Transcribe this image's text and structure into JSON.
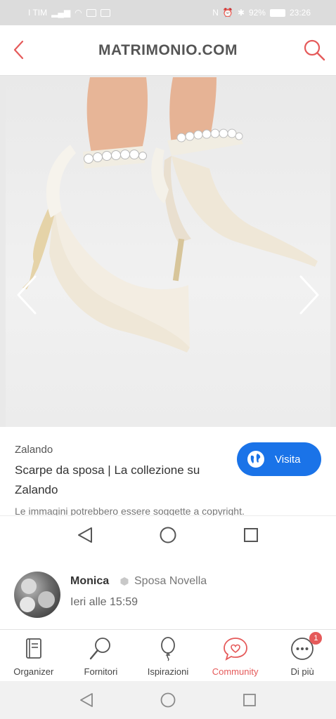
{
  "status_bar": {
    "carrier": "I TIM",
    "battery": "92%",
    "time": "23:26"
  },
  "header": {
    "title": "MATRIMONIO.COM",
    "back_icon": "chevron-left-icon",
    "search_icon": "search-icon"
  },
  "gallery": {
    "prev_icon": "chevron-left-icon",
    "next_icon": "chevron-right-icon"
  },
  "card": {
    "source": "Zalando",
    "title": "Scarpe da sposa | La collezione su Zalando",
    "visit_label": "Visita",
    "copyright": "Le immagini potrebbero essere soggette a copyright."
  },
  "post": {
    "user": "Monica",
    "role": "Sposa Novella",
    "time": "Ieri alle 15:59"
  },
  "tabs": [
    {
      "label": "Organizer",
      "icon": "book-icon"
    },
    {
      "label": "Fornitori",
      "icon": "magnifier-icon"
    },
    {
      "label": "Ispirazioni",
      "icon": "balloon-icon"
    },
    {
      "label": "Community",
      "icon": "chat-heart-icon"
    },
    {
      "label": "Di più",
      "icon": "more-icon",
      "badge": "1"
    }
  ],
  "colors": {
    "accent": "#e55a5a",
    "visit_button": "#1a73e8"
  }
}
